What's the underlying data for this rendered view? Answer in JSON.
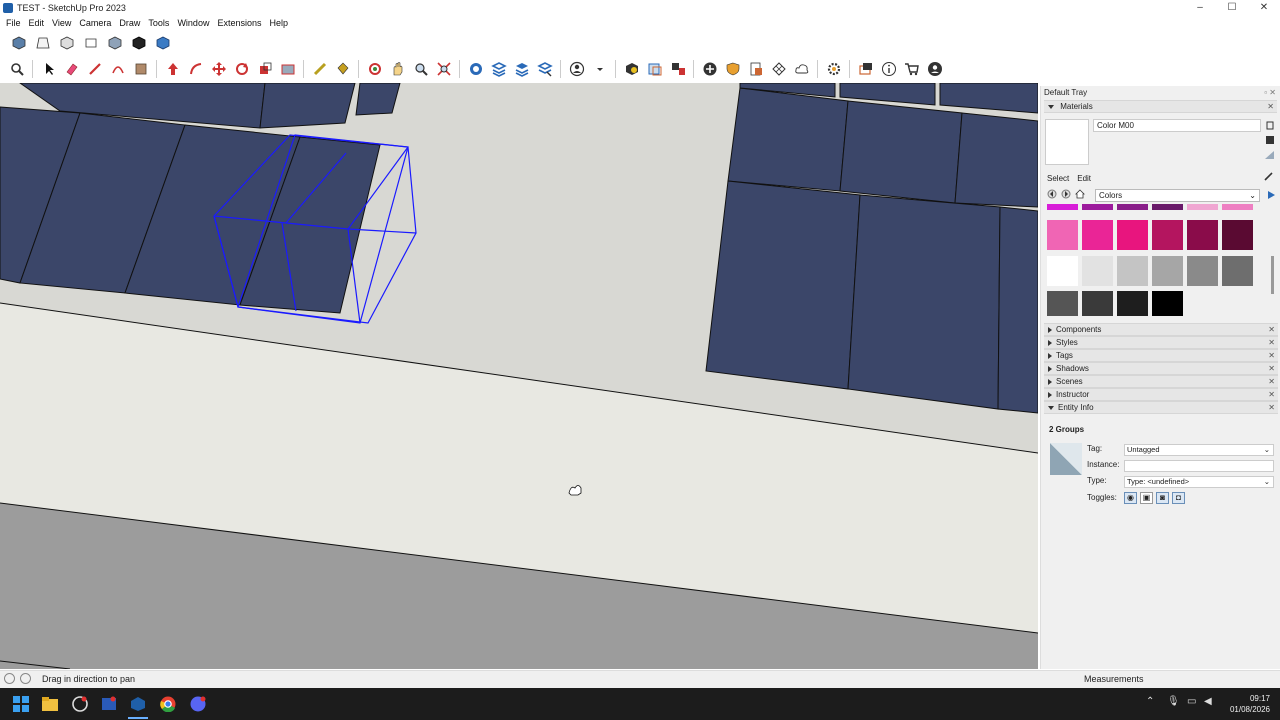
{
  "window": {
    "title": "TEST - SketchUp Pro 2023",
    "controls": [
      "–",
      "☐",
      "✕"
    ]
  },
  "menu": [
    "File",
    "Edit",
    "View",
    "Camera",
    "Draw",
    "Tools",
    "Window",
    "Extensions",
    "Help"
  ],
  "toolbar_top": [
    "iso-view",
    "top-view",
    "front-view",
    "right-view",
    "back-view",
    "left-view",
    "bottom-view"
  ],
  "toolbar_main": [
    "search",
    "select",
    "eraser",
    "pencil",
    "shapes",
    "push-pull",
    "move",
    "follow-me",
    "rotate",
    "scale",
    "offset",
    "tape-measure",
    "paint-bucket",
    "orbit",
    "pan",
    "zoom",
    "zoom-extents",
    "section",
    "layers",
    "styles",
    "scenes",
    "account",
    "3d-warehouse",
    "extension-manager",
    "components",
    "add-location",
    "dynamic",
    "export",
    "solar",
    "cloud",
    "settings",
    "sandbox",
    "info",
    "shop",
    "profile"
  ],
  "tray": {
    "title": "Default Tray",
    "materials": {
      "header": "Materials",
      "current_name": "Color M00",
      "tabs": [
        "Select",
        "Edit"
      ],
      "library": "Colors",
      "swatch_colors": [
        [
          "#d81ed8",
          "#9c1a9c",
          "#8a1e8a",
          "#6a1a6a",
          "#f0a6d2",
          "#ee7fc2"
        ],
        [
          "#f065b4",
          "#ea2596",
          "#e8157e",
          "#b4155f",
          "#8a0c4a",
          "#5a0a32"
        ],
        [
          "#ffffff",
          "#e2e2e2",
          "#c4c4c4",
          "#a6a6a6",
          "#8a8a8a",
          "#6e6e6e"
        ],
        [
          "#555555",
          "#3a3a3a",
          "#1e1e1e",
          "#000000"
        ]
      ]
    },
    "panels": [
      "Components",
      "Styles",
      "Tags",
      "Shadows",
      "Scenes",
      "Instructor",
      "Entity Info"
    ],
    "entity_info": {
      "count": "2 Groups",
      "tag_label": "Tag:",
      "tag_value": "Untagged",
      "instance_label": "Instance:",
      "instance_value": "",
      "type_label": "Type:",
      "type_value": "Type: <undefined>",
      "toggles_label": "Toggles:"
    }
  },
  "status": {
    "hint": "Drag in direction to pan",
    "measurements": "Measurements"
  },
  "taskbar": {
    "time": "09:17",
    "date": "01/08/2026"
  },
  "colors": {
    "panel_fill": "#3b4669",
    "selection": "#1a1aff",
    "ground": "#e8e8e2",
    "road": "#9a9a9a"
  }
}
